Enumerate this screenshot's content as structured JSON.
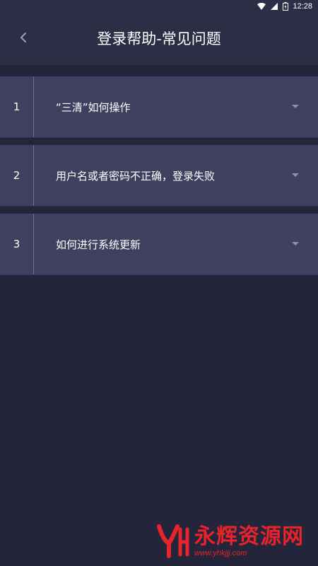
{
  "status_bar": {
    "time": "12:28",
    "icons": [
      "wifi-icon",
      "signal-icon",
      "battery-icon"
    ]
  },
  "header": {
    "title": "登录帮助-常见问题",
    "back_icon": "chevron-left-icon"
  },
  "faq": {
    "items": [
      {
        "number": "1",
        "question": "“三清”如何操作"
      },
      {
        "number": "2",
        "question": "用户名或者密码不正确，登录失败"
      },
      {
        "number": "3",
        "question": "如何进行系统更新"
      }
    ],
    "expand_icon": "caret-down-icon"
  },
  "watermark": {
    "name": "永辉资源网",
    "url": "www.yhkjjj.com"
  },
  "colors": {
    "background": "#23253a",
    "header": "#2c2e45",
    "item": "#3f3f5f",
    "divider": "#6e6f94",
    "watermark": "#e8232b"
  }
}
